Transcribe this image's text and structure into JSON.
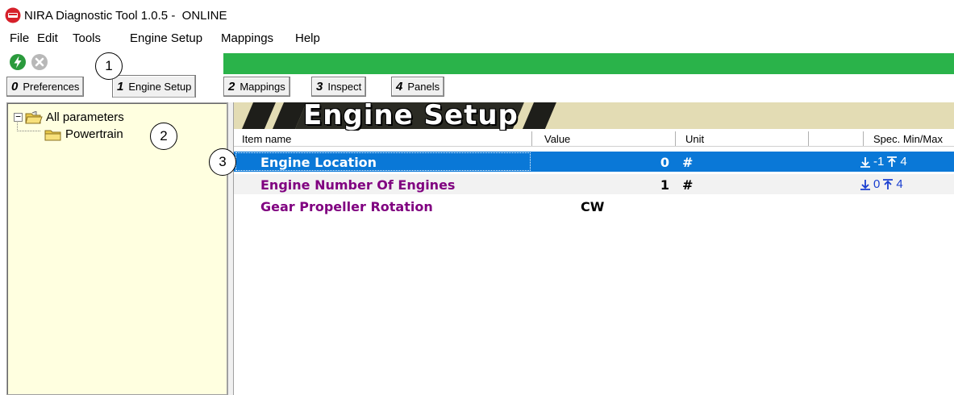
{
  "window": {
    "title": "NIRA Diagnostic Tool 1.0.5 -  ONLINE"
  },
  "menu": {
    "file": "File",
    "edit": "Edit",
    "tools": "Tools",
    "engine_setup": "Engine Setup",
    "mappings": "Mappings",
    "help": "Help"
  },
  "toolbar": {
    "connect_icon": "lightning-circle-icon",
    "disconnect_icon": "close-circle-icon",
    "progress_color": "#2ab34a",
    "progress_fraction": 1.0
  },
  "callouts": {
    "one": "1",
    "two": "2",
    "three": "3"
  },
  "tabs": [
    {
      "num": "0",
      "label": "Preferences"
    },
    {
      "num": "1",
      "label": "Engine Setup"
    },
    {
      "num": "2",
      "label": "Mappings"
    },
    {
      "num": "3",
      "label": "Inspect"
    },
    {
      "num": "4",
      "label": "Panels"
    }
  ],
  "active_tab": "Engine Setup",
  "tree": {
    "root": {
      "expander": "−",
      "label": "All parameters"
    },
    "child": {
      "label": "Powertrain"
    }
  },
  "panel": {
    "banner_title": "Engine Setup",
    "columns": {
      "item_name": "Item name",
      "value": "Value",
      "unit": "Unit",
      "spec": "Spec. Min/Max"
    },
    "rows": [
      {
        "name": "Engine Location",
        "value": "0",
        "unit": "#",
        "min": "-1",
        "max": "4",
        "selected": true
      },
      {
        "name": "Engine Number Of Engines",
        "value": "1",
        "unit": "#",
        "min": "0",
        "max": "4",
        "selected": false
      },
      {
        "name": "Gear Propeller Rotation",
        "value": "CW",
        "unit": "",
        "min": "",
        "max": "",
        "selected": false
      }
    ]
  },
  "colors": {
    "selection": "#0a78d7",
    "param_name": "#800080",
    "tree_background": "#ffffe0",
    "spec_icon": "#1a3fd0"
  }
}
